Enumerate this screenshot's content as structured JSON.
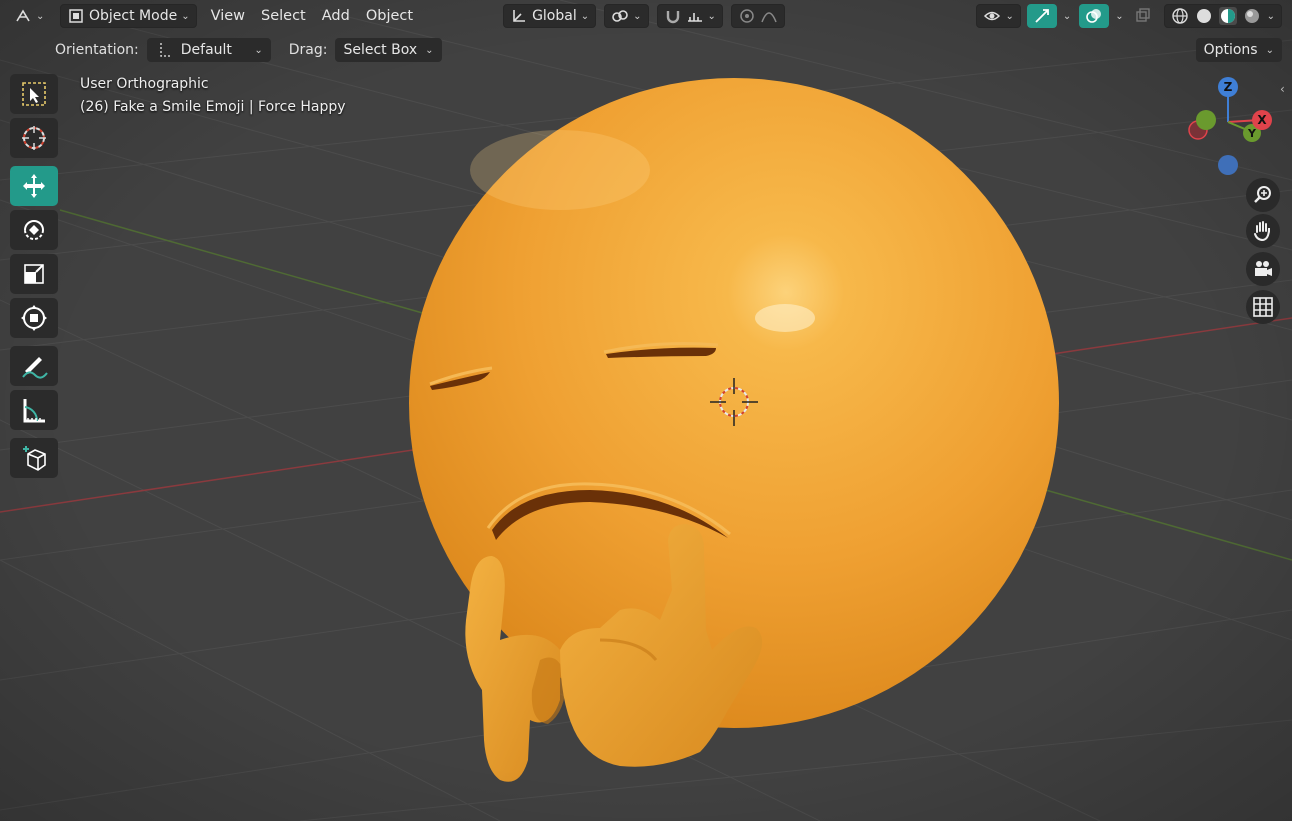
{
  "header": {
    "mode": "Object Mode",
    "menus": [
      "View",
      "Select",
      "Add",
      "Object"
    ],
    "transform_orientation": "Global",
    "options": "Options"
  },
  "subheader": {
    "orientation_label": "Orientation:",
    "orientation_value": "Default",
    "drag_label": "Drag:",
    "drag_value": "Select Box"
  },
  "viewport": {
    "view_name": "User Orthographic",
    "object_info": "(26) Fake a Smile Emoji | Force Happy"
  },
  "gizmo": {
    "z": "Z",
    "y": "Y",
    "x": "X"
  },
  "toolbar": [
    "select-box",
    "cursor",
    "move",
    "rotate",
    "scale",
    "transform",
    "annotate",
    "measure",
    "add-cube"
  ],
  "colors": {
    "accent": "#239a8a",
    "emoji": "#f2a530",
    "axis_x": "#e0434b",
    "axis_y": "#6a9a2e",
    "axis_z": "#3f7fd6"
  }
}
